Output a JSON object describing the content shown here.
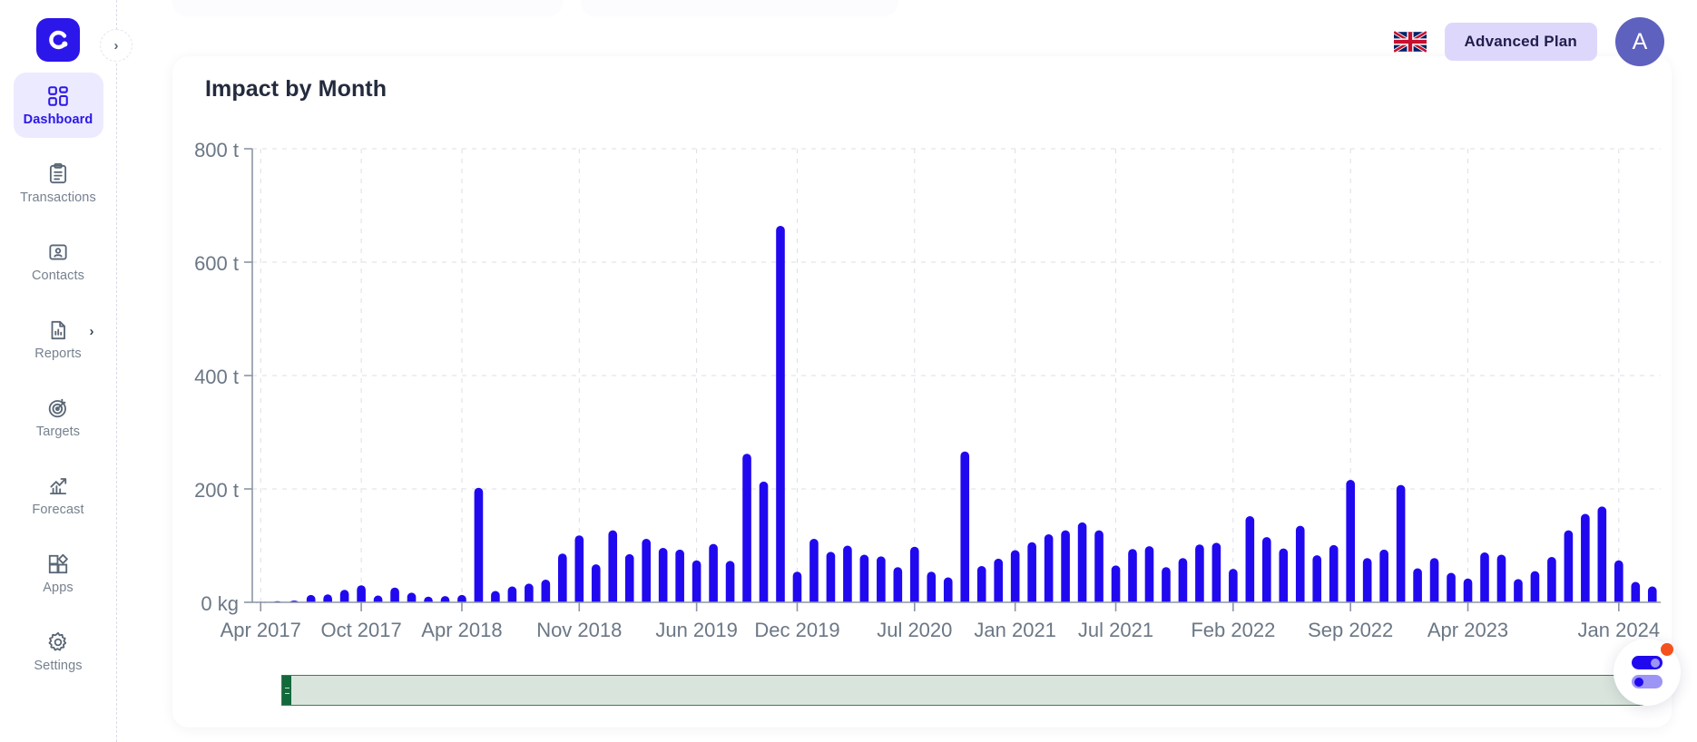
{
  "app": {
    "logo_name": "e-logo",
    "sidebar_toggle_icon": "chevron-right-icon"
  },
  "sidebar": {
    "items": [
      {
        "label": "Dashboard",
        "icon": "dashboard-icon",
        "active": true,
        "has_submenu": false
      },
      {
        "label": "Transactions",
        "icon": "clipboard-icon",
        "active": false,
        "has_submenu": false
      },
      {
        "label": "Contacts",
        "icon": "contact-card-icon",
        "active": false,
        "has_submenu": false
      },
      {
        "label": "Reports",
        "icon": "report-chart-icon",
        "active": false,
        "has_submenu": true
      },
      {
        "label": "Targets",
        "icon": "target-icon",
        "active": false,
        "has_submenu": false
      },
      {
        "label": "Forecast",
        "icon": "trend-up-icon",
        "active": false,
        "has_submenu": false
      },
      {
        "label": "Apps",
        "icon": "apps-grid-icon",
        "active": false,
        "has_submenu": false
      },
      {
        "label": "Settings",
        "icon": "gear-icon",
        "active": false,
        "has_submenu": false
      }
    ],
    "submenu_chevron": "›"
  },
  "header": {
    "language_flag": "uk-flag-icon",
    "plan_label": "Advanced Plan",
    "avatar_initial": "A"
  },
  "colors": {
    "brand": "#2b17ea",
    "bar": "#2009ef",
    "active_nav_bg": "#eceaff",
    "plan_badge_bg": "#ddd8fb",
    "avatar_bg": "#5e61bd",
    "slider_track": "#d9e5dc",
    "slider_handle": "#12693a",
    "badge_dot": "#f4511e",
    "axis": "#6b7785",
    "grid": "#dcdfe6"
  },
  "range_slider": {
    "handle_left_icon": "drag-grip-icon",
    "handle_right_icon": "range-edge-icon"
  },
  "float_widget": {
    "icon": "toggles-icon",
    "badge_icon": "notification-dot-icon",
    "toggle_top_state": "on",
    "toggle_bottom_state": "off"
  },
  "chart_data": {
    "type": "bar",
    "title": "Impact by Month",
    "xlabel": "",
    "ylabel": "",
    "ylim": [
      0,
      800
    ],
    "grid": true,
    "legend": null,
    "y_ticks": [
      0,
      200,
      400,
      600,
      800
    ],
    "y_tick_labels": [
      "0 kg",
      "200 t",
      "400 t",
      "600 t",
      "800 t"
    ],
    "x_tick_labels": [
      "Apr 2017",
      "Oct 2017",
      "Apr 2018",
      "Nov 2018",
      "Jun 2019",
      "Dec 2019",
      "Jul 2020",
      "Jan 2021",
      "Jul 2021",
      "Feb 2022",
      "Sep 2022",
      "Apr 2023",
      "Jan 2024"
    ],
    "x_tick_indices": [
      0,
      6,
      12,
      19,
      26,
      32,
      39,
      45,
      51,
      58,
      65,
      72,
      81
    ],
    "categories": [
      "Apr 2017",
      "May 2017",
      "Jun 2017",
      "Jul 2017",
      "Aug 2017",
      "Sep 2017",
      "Oct 2017",
      "Nov 2017",
      "Dec 2017",
      "Jan 2018",
      "Feb 2018",
      "Mar 2018",
      "Apr 2018",
      "May 2018",
      "Jun 2018",
      "Jul 2018",
      "Aug 2018",
      "Sep 2018",
      "Oct 2018",
      "Nov 2018",
      "Dec 2018",
      "Jan 2019",
      "Feb 2019",
      "Mar 2019",
      "Apr 2019",
      "May 2019",
      "Jun 2019",
      "Jul 2019",
      "Aug 2019",
      "Sep 2019",
      "Oct 2019",
      "Nov 2019",
      "Dec 2019",
      "Jan 2020",
      "Feb 2020",
      "Mar 2020",
      "Apr 2020",
      "May 2020",
      "Jun 2020",
      "Jul 2020",
      "Aug 2020",
      "Sep 2020",
      "Oct 2020",
      "Nov 2020",
      "Dec 2020",
      "Jan 2021",
      "Feb 2021",
      "Mar 2021",
      "Apr 2021",
      "May 2021",
      "Jun 2021",
      "Jul 2021",
      "Aug 2021",
      "Sep 2021",
      "Oct 2021",
      "Nov 2021",
      "Dec 2021",
      "Jan 2022",
      "Feb 2022",
      "Mar 2022",
      "Apr 2022",
      "May 2022",
      "Jun 2022",
      "Jul 2022",
      "Aug 2022",
      "Sep 2022",
      "Oct 2022",
      "Nov 2022",
      "Dec 2022",
      "Jan 2023",
      "Feb 2023",
      "Mar 2023",
      "Apr 2023",
      "May 2023",
      "Jun 2023",
      "Jul 2023",
      "Aug 2023",
      "Sep 2023",
      "Oct 2023",
      "Nov 2023",
      "Dec 2023",
      "Jan 2024",
      "Feb 2024",
      "Mar 2024"
    ],
    "values": [
      1,
      2,
      3,
      13,
      14,
      22,
      30,
      12,
      26,
      17,
      10,
      11,
      13,
      202,
      20,
      28,
      33,
      40,
      86,
      118,
      67,
      127,
      85,
      112,
      96,
      93,
      74,
      103,
      73,
      262,
      213,
      664,
      54,
      112,
      89,
      100,
      84,
      81,
      62,
      98,
      54,
      44,
      266,
      64,
      77,
      92,
      106,
      120,
      127,
      141,
      127,
      65,
      94,
      99,
      62,
      78,
      102,
      105,
      59,
      152,
      115,
      95,
      135,
      83,
      101,
      216,
      78,
      93,
      207,
      60,
      78,
      52,
      42,
      88,
      84,
      41,
      55,
      80,
      127,
      156,
      169,
      74,
      36,
      28
    ]
  }
}
